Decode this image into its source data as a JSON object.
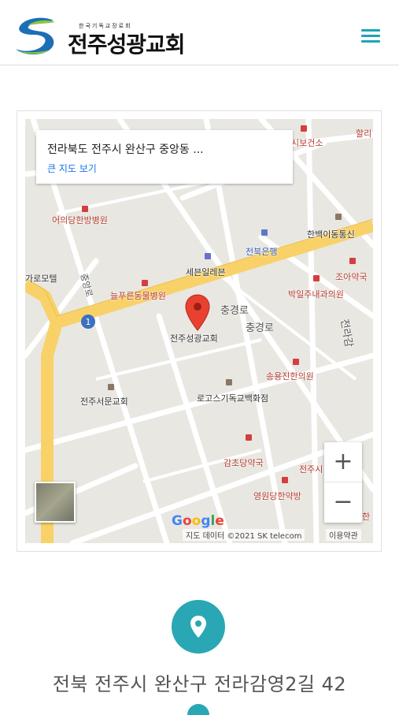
{
  "header": {
    "logo_small_text": "한국기독교장로회",
    "logo_name": "전주성광교회",
    "menu_icon": "hamburger-icon",
    "accent_color": "#1aa6b7"
  },
  "map": {
    "info_title": "전라북도 전주시 완산구 중앙동 ...",
    "info_link": "큰 지도 보기",
    "zoom_in": "+",
    "zoom_out": "−",
    "attribution": "지도 데이터 ©2021 SK telecom",
    "terms": "이용약관",
    "google_logo": "Google",
    "route_number": "1",
    "labels": {
      "l1": "어의당한방병원",
      "l2": "시보건소",
      "l3": "할리",
      "l4": "한백이동통신",
      "l5": "전북은행",
      "l6": "세븐일레븐",
      "l7": "조아약국",
      "l8": "가로모텔",
      "l9": "늘푸른동물병원",
      "l10": "박일주내과의원",
      "l11": "충경로",
      "l12": "충경로",
      "l13": "전주성광교회",
      "l14": "송용진한의원",
      "l15": "전주서문교회",
      "l16": "로고스기독교백화점",
      "l17": "감초당약국",
      "l18": "전주시",
      "l19": "영원당한약방",
      "l20": "전라감",
      "l21": "중앙로",
      "l22": "한"
    }
  },
  "address": {
    "pin_icon": "location-pin-icon",
    "text": "전북 전주시 완산구 전라감영2길 42"
  }
}
